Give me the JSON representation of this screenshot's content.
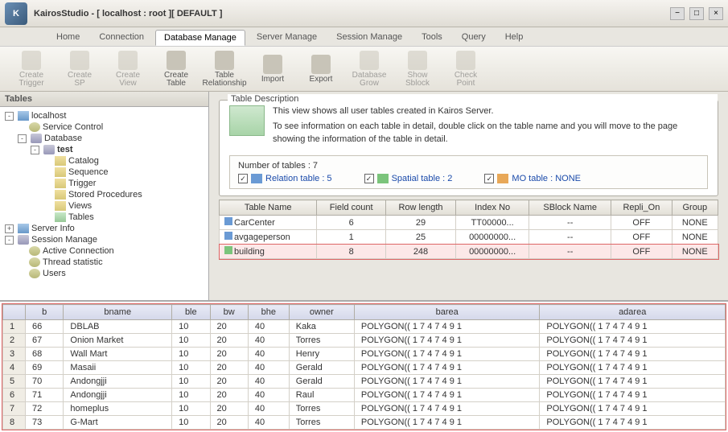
{
  "window": {
    "title": "KairosStudio - [ localhost : root ][ DEFAULT ]"
  },
  "menus": [
    {
      "label": "Home",
      "active": false
    },
    {
      "label": "Connection",
      "active": false
    },
    {
      "label": "Database Manage",
      "active": true
    },
    {
      "label": "Server Manage",
      "active": false
    },
    {
      "label": "Session Manage",
      "active": false
    },
    {
      "label": "Tools",
      "active": false
    },
    {
      "label": "Query",
      "active": false
    },
    {
      "label": "Help",
      "active": false
    }
  ],
  "toolbar": [
    {
      "label": "Create\nTrigger",
      "name": "create-trigger",
      "disabled": true
    },
    {
      "label": "Create\nSP",
      "name": "create-sp",
      "disabled": true
    },
    {
      "label": "Create\nView",
      "name": "create-view",
      "disabled": true
    },
    {
      "label": "Create\nTable",
      "name": "create-table",
      "disabled": false
    },
    {
      "label": "Table\nRelationship",
      "name": "table-relationship",
      "disabled": false
    },
    {
      "label": "Import",
      "name": "import",
      "disabled": false
    },
    {
      "label": "Export",
      "name": "export",
      "disabled": false
    },
    {
      "label": "Database\nGrow",
      "name": "database-grow",
      "disabled": true
    },
    {
      "label": "Show\nSblock",
      "name": "show-sblock",
      "disabled": true
    },
    {
      "label": "Check\nPoint",
      "name": "check-point",
      "disabled": true
    }
  ],
  "sidebar": {
    "title": "Tables"
  },
  "tree": [
    {
      "level": 0,
      "exp": "-",
      "icon": "i-server",
      "label": "localhost"
    },
    {
      "level": 1,
      "exp": "",
      "icon": "i-gear",
      "label": "Service Control"
    },
    {
      "level": 1,
      "exp": "-",
      "icon": "i-db",
      "label": "Database"
    },
    {
      "level": 2,
      "exp": "-",
      "icon": "i-db",
      "label": "test",
      "bold": true
    },
    {
      "level": 3,
      "exp": "",
      "icon": "i-folder",
      "label": "Catalog"
    },
    {
      "level": 3,
      "exp": "",
      "icon": "i-folder",
      "label": "Sequence"
    },
    {
      "level": 3,
      "exp": "",
      "icon": "i-folder",
      "label": "Trigger"
    },
    {
      "level": 3,
      "exp": "",
      "icon": "i-folder",
      "label": "Stored Procedures"
    },
    {
      "level": 3,
      "exp": "",
      "icon": "i-folder",
      "label": "Views"
    },
    {
      "level": 3,
      "exp": "",
      "icon": "i-table",
      "label": "Tables",
      "bold": false
    },
    {
      "level": 0,
      "exp": "+",
      "icon": "i-server",
      "label": "Server Info"
    },
    {
      "level": 0,
      "exp": "-",
      "icon": "i-db",
      "label": "Session Manage"
    },
    {
      "level": 1,
      "exp": "",
      "icon": "i-gear",
      "label": "Active Connection"
    },
    {
      "level": 1,
      "exp": "",
      "icon": "i-gear",
      "label": "Thread statistic"
    },
    {
      "level": 1,
      "exp": "",
      "icon": "i-gear",
      "label": "Users"
    }
  ],
  "desc": {
    "legend": "Table Description",
    "line1": "This view shows all user tables created in Kairos Server.",
    "line2": "To see information on each table in detail, double click on the table name and you will move to the page showing the information of the table in detail."
  },
  "stats": {
    "title": "Number of tables : 7",
    "items": [
      {
        "label": "Relation table : 5",
        "icon": "i-blue"
      },
      {
        "label": "Spatial table : 2",
        "icon": "i-green"
      },
      {
        "label": "MO table : NONE",
        "icon": "i-orange"
      }
    ]
  },
  "tablelist": {
    "headers": [
      "Table Name",
      "Field count",
      "Row length",
      "Index No",
      "SBlock Name",
      "Repli_On",
      "Group"
    ],
    "rows": [
      {
        "name": "CarCenter",
        "fc": "6",
        "rl": "29",
        "idx": "TT00000...",
        "sb": "--",
        "rep": "OFF",
        "grp": "NONE",
        "sel": false,
        "icon": "i-blue"
      },
      {
        "name": "avgageperson",
        "fc": "1",
        "rl": "25",
        "idx": "00000000...",
        "sb": "--",
        "rep": "OFF",
        "grp": "NONE",
        "sel": false,
        "icon": "i-blue"
      },
      {
        "name": "building",
        "fc": "8",
        "rl": "248",
        "idx": "00000000...",
        "sb": "--",
        "rep": "OFF",
        "grp": "NONE",
        "sel": true,
        "icon": "i-green"
      }
    ]
  },
  "grid": {
    "headers": [
      "",
      "b",
      "bname",
      "ble",
      "bw",
      "bhe",
      "owner",
      "barea",
      "adarea"
    ],
    "rows": [
      [
        "1",
        "66",
        "DBLAB",
        "10",
        "20",
        "40",
        "Kaka",
        "POLYGON(( 1 7 4 7 4 9 1",
        "POLYGON(( 1 7 4 7 4 9 1"
      ],
      [
        "2",
        "67",
        "Onion Market",
        "10",
        "20",
        "40",
        "Torres",
        "POLYGON(( 1 7 4 7 4 9 1",
        "POLYGON(( 1 7 4 7 4 9 1"
      ],
      [
        "3",
        "68",
        "Wall Mart",
        "10",
        "20",
        "40",
        "Henry",
        "POLYGON(( 1 7 4 7 4 9 1",
        "POLYGON(( 1 7 4 7 4 9 1"
      ],
      [
        "4",
        "69",
        "Masaii",
        "10",
        "20",
        "40",
        "Gerald",
        "POLYGON(( 1 7 4 7 4 9 1",
        "POLYGON(( 1 7 4 7 4 9 1"
      ],
      [
        "5",
        "70",
        "Andongjji",
        "10",
        "20",
        "40",
        "Gerald",
        "POLYGON(( 1 7 4 7 4 9 1",
        "POLYGON(( 1 7 4 7 4 9 1"
      ],
      [
        "6",
        "71",
        "Andongjji",
        "10",
        "20",
        "40",
        "Raul",
        "POLYGON(( 1 7 4 7 4 9 1",
        "POLYGON(( 1 7 4 7 4 9 1"
      ],
      [
        "7",
        "72",
        "homeplus",
        "10",
        "20",
        "40",
        "Torres",
        "POLYGON(( 1 7 4 7 4 9 1",
        "POLYGON(( 1 7 4 7 4 9 1"
      ],
      [
        "8",
        "73",
        "G-Mart",
        "10",
        "20",
        "40",
        "Torres",
        "POLYGON(( 1 7 4 7 4 9 1",
        "POLYGON(( 1 7 4 7 4 9 1"
      ]
    ]
  }
}
